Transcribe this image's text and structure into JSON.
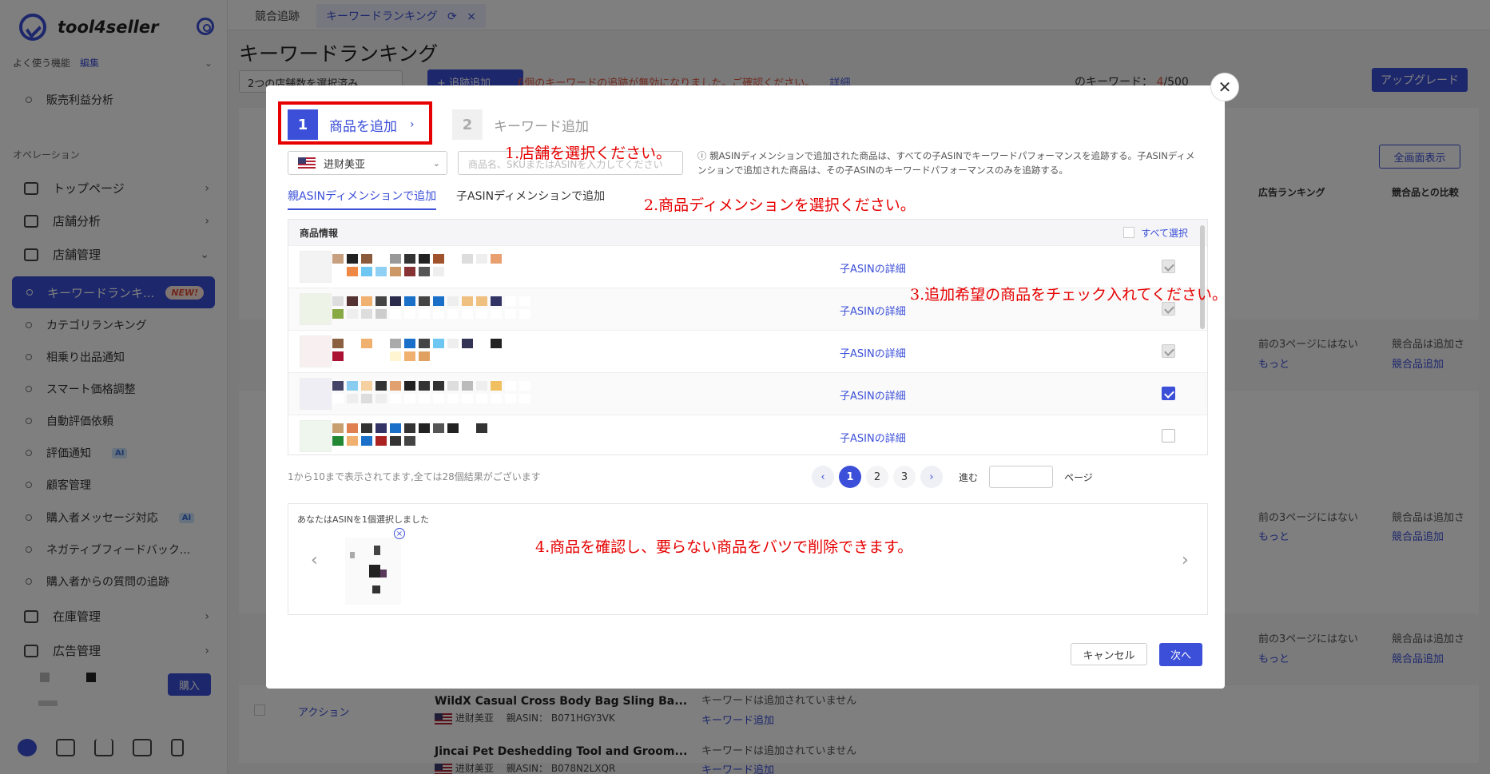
{
  "sidebar": {
    "brand": "tool4seller",
    "favorites_label": "よく使う機能",
    "favorites_edit": "編集",
    "fav_items": [
      "販売利益分析"
    ],
    "operations_label": "オペレーション",
    "menu": [
      {
        "label": "トップページ"
      },
      {
        "label": "店舗分析"
      },
      {
        "label": "店舗管理"
      }
    ],
    "active_item": {
      "label": "キーワードランキ...",
      "badge": "NEW!"
    },
    "sub_items": [
      {
        "label": "カテゴリランキング"
      },
      {
        "label": "相乗り出品通知"
      },
      {
        "label": "スマート価格調整"
      },
      {
        "label": "自動評価依頼"
      },
      {
        "label": "評価通知",
        "badge": "AI"
      },
      {
        "label": "顧客管理"
      },
      {
        "label": "購入者メッセージ対応",
        "badge": "AI"
      },
      {
        "label": "ネガティブフィードバック..."
      },
      {
        "label": "購入者からの質問の追跡"
      }
    ],
    "menu_bottom": [
      {
        "label": "在庫管理"
      },
      {
        "label": "広告管理"
      }
    ],
    "buy_label": "購入"
  },
  "tabs": [
    {
      "label": "競合追跡"
    },
    {
      "label": "キーワードランキング"
    }
  ],
  "page": {
    "title": "キーワードランキング",
    "store_select": "2つの店舗数を選択済み",
    "add_button": "+ 追跡追加",
    "warning": "6個のキーワードの追跡が無効になりました。ご確認ください。",
    "warning_link": "詳細",
    "keyword_count_label": "のキーワード：",
    "keyword_count_used": "4",
    "keyword_count_total": "/500",
    "upgrade": "アップグレード",
    "fullscreen": "全画面表示",
    "col_ad_rank": "広告ランキング",
    "col_compare": "競合品との比較",
    "row_not_in_3pages": "前の3ページにはない",
    "row_more": "もっと",
    "row_compare_text": "競合品は追加さ",
    "row_compare_link": "競合品追加",
    "row_action": "アクション",
    "row_no_keyword": "キーワードは追加されていません",
    "row_add_keyword": "キーワード追加",
    "products": [
      {
        "name": "WildX Casual Cross Body Bag Sling Ba...",
        "store": "进财美亚",
        "asin_label": "親ASIN：",
        "asin": "B071HGY3VK"
      },
      {
        "name": "Jincai Pet Deshedding Tool and Groom...",
        "store": "进财美亚",
        "asin_label": "親ASIN：",
        "asin": "B078N2LXQR"
      }
    ]
  },
  "modal": {
    "step1_num": "1",
    "step1_label": "商品を追加",
    "step2_num": "2",
    "step2_label": "キーワード追加",
    "store": "进财美亚",
    "search_placeholder": "商品名、SKUまたはASINを入力してください",
    "info": "親ASINディメンションで追加された商品は、すべての子ASINでキーワードパフォーマンスを追跡する。子ASINディメンションで追加された商品は、その子ASINのキーワードパフォーマンスのみを追跡する。",
    "tab_parent": "親ASINディメンションで追加",
    "tab_child": "子ASINディメンションで追加",
    "table_header": "商品情報",
    "select_all": "すべて選択",
    "row_link": "子ASINの詳細",
    "rows": [
      {
        "state": "disabled"
      },
      {
        "state": "disabled"
      },
      {
        "state": "disabled"
      },
      {
        "state": "checked"
      },
      {
        "state": "unchecked"
      }
    ],
    "pager_info": "1から10まで表示されてます,全ては28個結果がございます",
    "pages": [
      "1",
      "2",
      "3"
    ],
    "goto_label": "進む",
    "page_label": "ページ",
    "selected_title": "あなたはASINを1個選択しました",
    "cancel": "キャンセル",
    "next": "次へ"
  },
  "annotations": {
    "a1": "1.店舗を選択ください。",
    "a2": "2.商品ディメンションを選択ください。",
    "a3": "3.追加希望の商品をチェック入れてください。",
    "a4": "4.商品を確認し、要らない商品をバツで削除できます。"
  },
  "colors": {
    "accent": "#3b4fd8",
    "annotation": "#e60000",
    "warning": "#e0533b"
  }
}
